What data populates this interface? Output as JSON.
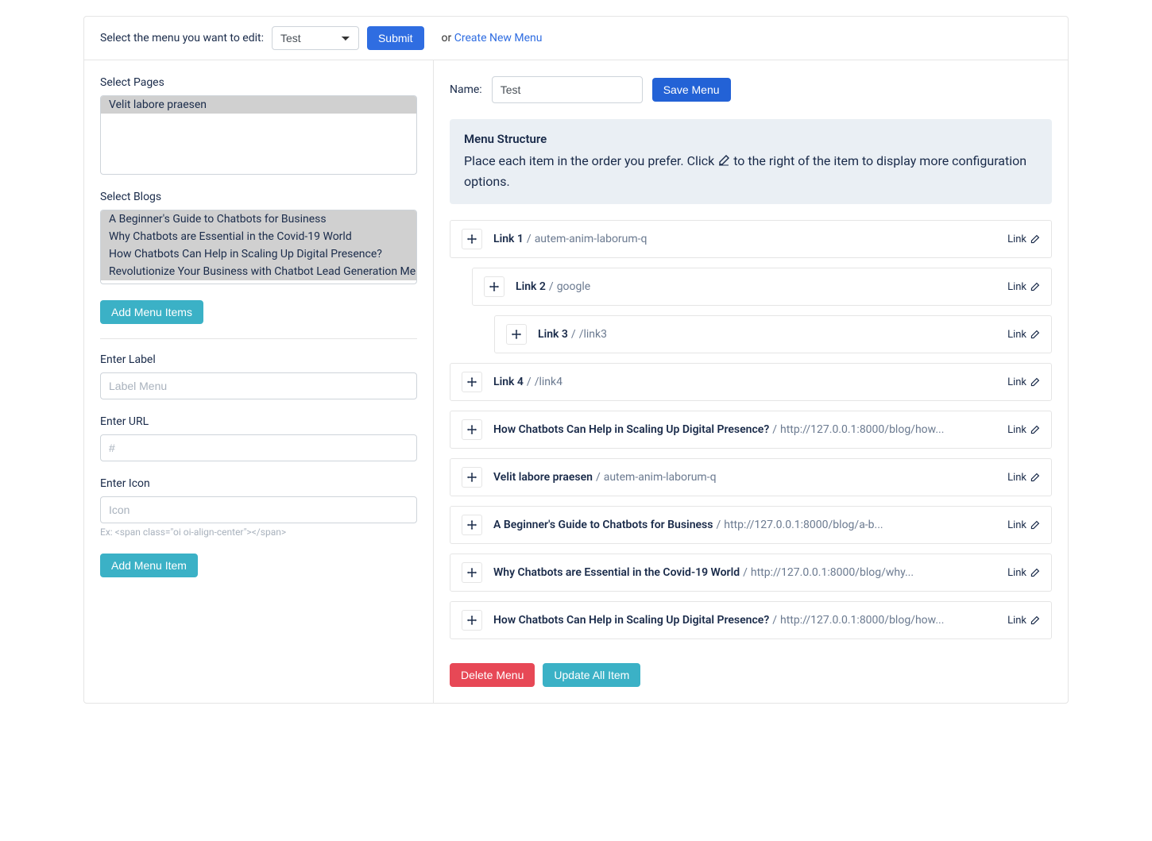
{
  "topbar": {
    "label": "Select the menu you want to edit:",
    "selected": "Test",
    "submit": "Submit",
    "or": "or",
    "create_link": "Create New Menu"
  },
  "sidebar": {
    "pages_label": "Select Pages",
    "pages": [
      "Velit labore praesen"
    ],
    "blogs_label": "Select Blogs",
    "blogs": [
      "A Beginner's Guide to Chatbots for Business",
      "Why Chatbots are Essential in the Covid-19 World",
      "How Chatbots Can Help in Scaling Up Digital Presence?",
      "Revolutionize Your Business with Chatbot Lead Generation Me"
    ],
    "add_items": "Add Menu Items",
    "label_label": "Enter Label",
    "label_placeholder": "Label Menu",
    "url_label": "Enter URL",
    "url_placeholder": "#",
    "icon_label": "Enter Icon",
    "icon_placeholder": "Icon",
    "icon_help": "Ex: <span class=\"oi oi-align-center\"></span>",
    "add_item": "Add Menu Item"
  },
  "content": {
    "name_label": "Name:",
    "name_value": "Test",
    "save": "Save Menu",
    "structure_title": "Menu Structure",
    "structure_text_a": "Place each item in the order you prefer. Click ",
    "structure_text_b": " to the right of the item to display more configuration options.",
    "rows": [
      {
        "title": "Link 1",
        "path": "autem-anim-laborum-q",
        "indent": 0
      },
      {
        "title": "Link 2",
        "path": "google",
        "indent": 1
      },
      {
        "title": "Link 3",
        "path": "/link3",
        "indent": 2
      },
      {
        "title": "Link 4",
        "path": "/link4",
        "indent": 0
      },
      {
        "title": "How Chatbots Can Help in Scaling Up Digital Presence?",
        "path": "http://127.0.0.1:8000/blog/how...",
        "indent": 0
      },
      {
        "title": "Velit labore praesen",
        "path": "autem-anim-laborum-q",
        "indent": 0
      },
      {
        "title": "A Beginner's Guide to Chatbots for Business",
        "path": "http://127.0.0.1:8000/blog/a-b...",
        "indent": 0
      },
      {
        "title": "Why Chatbots are Essential in the Covid-19 World",
        "path": "http://127.0.0.1:8000/blog/why...",
        "indent": 0
      },
      {
        "title": "How Chatbots Can Help in Scaling Up Digital Presence?",
        "path": "http://127.0.0.1:8000/blog/how...",
        "indent": 0
      }
    ],
    "row_link_label": "Link",
    "delete": "Delete Menu",
    "update": "Update All Item"
  }
}
